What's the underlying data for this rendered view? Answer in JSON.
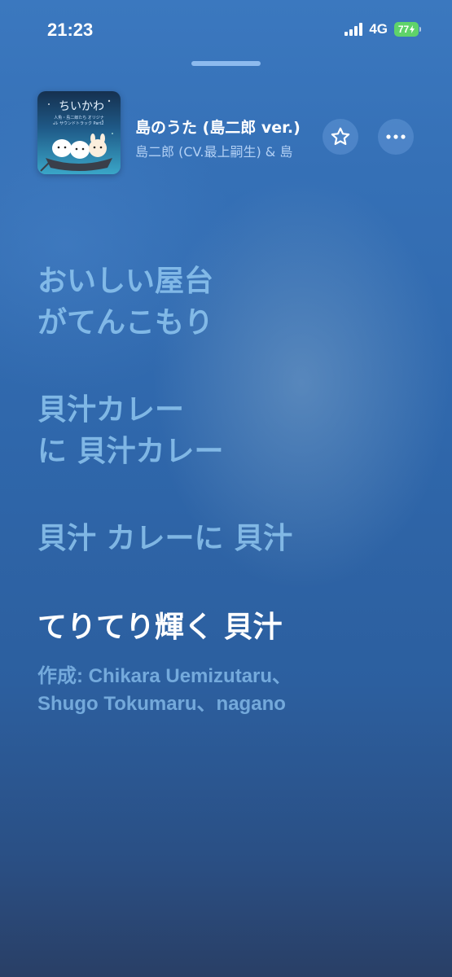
{
  "status_bar": {
    "time": "21:23",
    "network": "4G",
    "battery": "77"
  },
  "now_playing": {
    "album_art": {
      "title": "ちいかわ",
      "subtitle": "人魚・島二郎たち オリジナル サウンドトラック Part2"
    },
    "title": "島のうた (島二郎 ver.)",
    "artist": "島二郎 (CV.最上嗣生) & 島",
    "icons": [
      "star-icon",
      "more-icon"
    ]
  },
  "lyrics": [
    {
      "lines": [
        "おいしい屋台",
        "がてんこもり"
      ],
      "active": false
    },
    {
      "lines": [
        "貝汁カレー",
        "に 貝汁カレー"
      ],
      "active": false
    },
    {
      "lines": [
        "貝汁 カレーに 貝汁"
      ],
      "active": false
    },
    {
      "lines": [
        "てりてり輝く 貝汁"
      ],
      "active": true
    }
  ],
  "credits": {
    "line1": "作成: Chikara Uemizutaru、",
    "line2": "Shugo Tokumaru、nagano"
  },
  "colors": {
    "active_lyric": "#ffffff",
    "inactive_lyric": "#96cdf5",
    "battery": "#5fd36a"
  }
}
